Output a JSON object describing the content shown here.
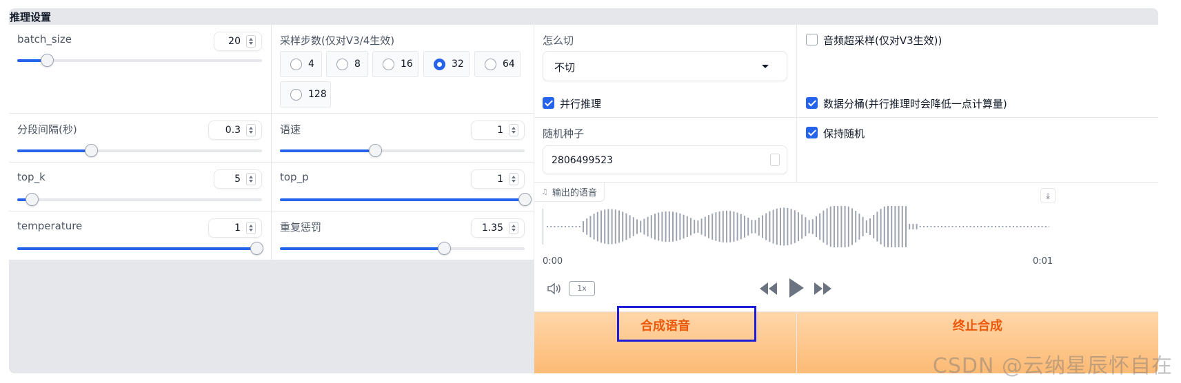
{
  "panel": {
    "title": "推理设置"
  },
  "batch_size": {
    "label": "batch_size",
    "value": "20",
    "fraction": 0.12
  },
  "sample_steps": {
    "label": "采样步数(仅对V3/4生效)",
    "options": [
      "4",
      "8",
      "16",
      "32",
      "64",
      "128"
    ],
    "selected": "32"
  },
  "segment_interval": {
    "label": "分段间隔(秒)",
    "value": "0.3",
    "fraction": 0.3
  },
  "speed": {
    "label": "语速",
    "value": "1",
    "fraction": 0.39
  },
  "top_k": {
    "label": "top_k",
    "value": "5",
    "fraction": 0.06
  },
  "top_p": {
    "label": "top_p",
    "value": "1",
    "fraction": 1.0
  },
  "temperature": {
    "label": "temperature",
    "value": "1",
    "fraction": 1.0
  },
  "repetition_penalty": {
    "label": "重复惩罚",
    "value": "1.35",
    "fraction": 0.67
  },
  "how_to_cut": {
    "label": "怎么切",
    "value": "不切"
  },
  "audio_super_sampling": {
    "label": "音频超采样(仅对V3生效))",
    "checked": false
  },
  "parallel_inference": {
    "label": "并行推理",
    "checked": true
  },
  "data_bucketing": {
    "label": "数据分桶(并行推理时会降低一点计算量)",
    "checked": true
  },
  "random_seed": {
    "label": "随机种子",
    "value": "2806499523"
  },
  "keep_random": {
    "label": "保持随机",
    "checked": true
  },
  "audio_output": {
    "label": "输出的语音",
    "current_time": "0:00",
    "duration": "0:01",
    "playback_rate": "1x",
    "icons": {
      "note": "music-note-icon",
      "download": "download-icon",
      "volume": "volume-icon",
      "rewind": "rewind-icon",
      "play": "play-icon",
      "forward": "fast-forward-icon"
    }
  },
  "buttons": {
    "synthesize": "合成语音",
    "stop": "终止合成"
  },
  "watermark": "CSDN @云纳星辰怀自在",
  "colors": {
    "accent": "#2563eb",
    "orange_text": "#ea580c",
    "highlight": "#1d1dd6"
  }
}
